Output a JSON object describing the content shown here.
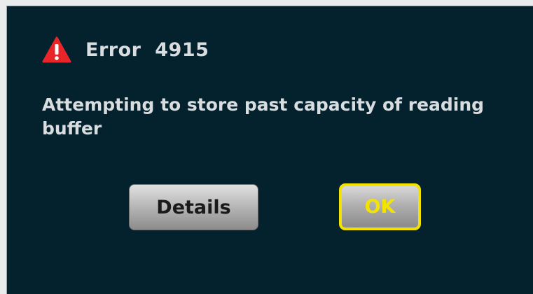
{
  "dialog": {
    "title": "Error  4915",
    "message": "Attempting to store past capacity of reading buffer",
    "icon": "warning-icon",
    "buttons": {
      "details_label": "Details",
      "ok_label": "OK"
    }
  },
  "colors": {
    "background": "#04222d",
    "text": "#d9dde0",
    "warning_icon": "#e8262a",
    "ok_highlight": "#f2e200"
  }
}
